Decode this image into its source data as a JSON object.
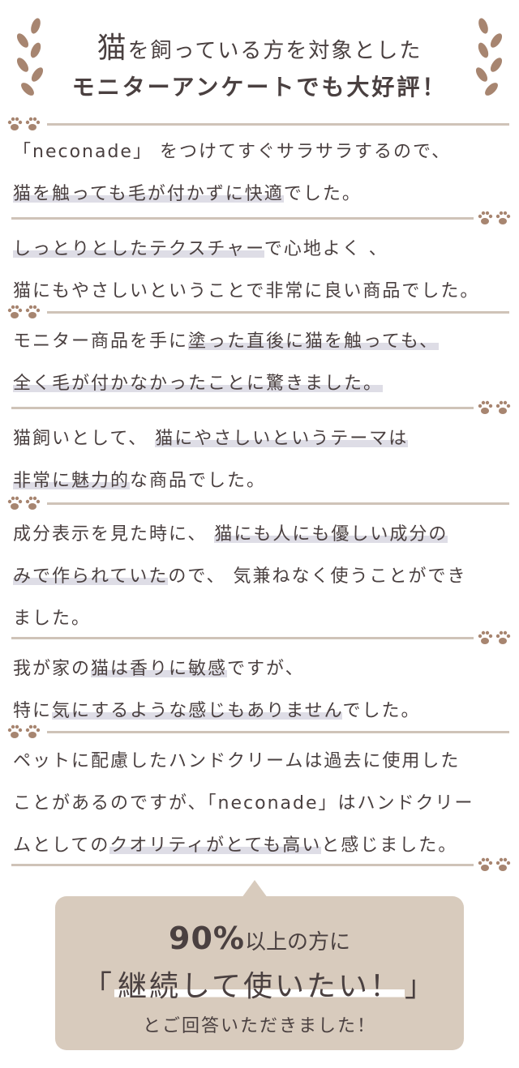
{
  "header": {
    "title_cat": "猫",
    "title_rest": "を飼っている方を対象とした",
    "subtitle": "モニターアンケートでも大好評！"
  },
  "colors": {
    "accent": "#a78570",
    "divider": "#cfc3b8",
    "highlight": "#dedde6",
    "callout_bg": "#d8cbbd",
    "text": "#4a4040"
  },
  "icons": [
    "laurel-icon",
    "paw-prints-icon"
  ],
  "reviews": [
    {
      "parts": [
        {
          "t": "「neconade」 をつけてすぐサラサラするので、"
        },
        {
          "t": "\n"
        },
        {
          "t": "猫を触っても毛が付かずに快適",
          "hl": true
        },
        {
          "t": "でした。"
        }
      ]
    },
    {
      "parts": [
        {
          "t": "しっとりとしたテクスチャー",
          "hl": true
        },
        {
          "t": "で心地よく 、"
        },
        {
          "t": "\n"
        },
        {
          "t": "猫にもやさしいということで非常に良い商品でした。"
        }
      ]
    },
    {
      "parts": [
        {
          "t": "モニター商品を手に"
        },
        {
          "t": "塗った直後に猫を触っても、",
          "hl": true
        },
        {
          "t": "\n"
        },
        {
          "t": "全く毛が付かなかったことに驚きました。",
          "hl": true
        }
      ]
    },
    {
      "parts": [
        {
          "t": "猫飼いとして、 "
        },
        {
          "t": "猫にやさしいというテーマは",
          "hl": true
        },
        {
          "t": "\n"
        },
        {
          "t": "非常に魅力的",
          "hl": true
        },
        {
          "t": "な商品でした。"
        }
      ]
    },
    {
      "parts": [
        {
          "t": "成分表示を見た時に、 "
        },
        {
          "t": "猫にも人にも優しい成分の",
          "hl": true
        },
        {
          "t": "\n"
        },
        {
          "t": "みで作られていた",
          "hl": true
        },
        {
          "t": "ので、 気兼ねなく使うことができ"
        },
        {
          "t": "\n"
        },
        {
          "t": "ました。"
        }
      ]
    },
    {
      "parts": [
        {
          "t": "我が家の"
        },
        {
          "t": "猫は香りに敏感",
          "hl": true
        },
        {
          "t": "ですが、"
        },
        {
          "t": "\n"
        },
        {
          "t": "特に"
        },
        {
          "t": "気にするような感じもありません",
          "hl": true
        },
        {
          "t": "でした。"
        }
      ]
    },
    {
      "parts": [
        {
          "t": "ペットに配慮したハンドクリームは過去に使用した"
        },
        {
          "t": "\n"
        },
        {
          "t": "ことがあるのですが、「neconade」はハンドクリー"
        },
        {
          "t": "\n"
        },
        {
          "t": "ムとしての"
        },
        {
          "t": "クオリティがとても高い",
          "hl": true
        },
        {
          "t": "と感じました。"
        }
      ]
    }
  ],
  "callout": {
    "percent": "90%",
    "line1_rest": "以上の方に",
    "open_bracket": "「",
    "quote": "継続して使いたい！",
    "close_bracket": "」",
    "line3": "とご回答いただきました！"
  }
}
